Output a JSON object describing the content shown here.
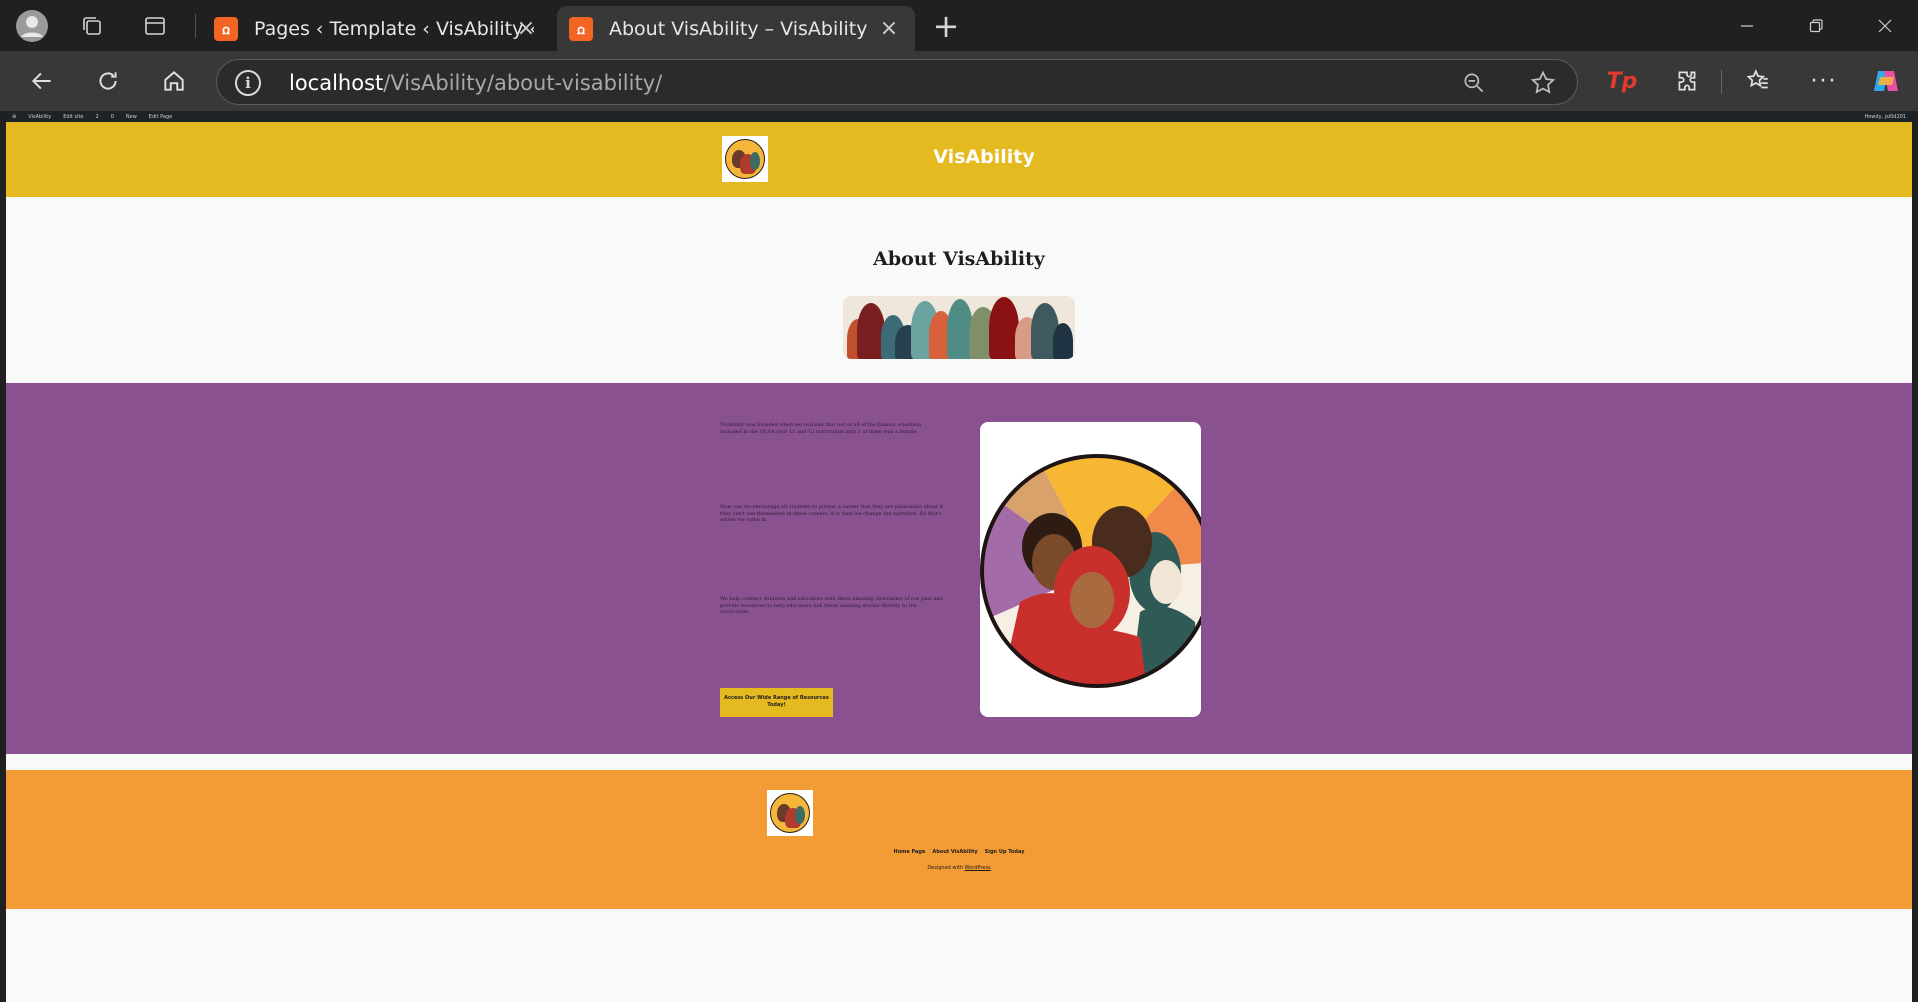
{
  "browser": {
    "tabs": [
      {
        "title": "Pages ‹ Template ‹ VisAbility ‹ Edit",
        "favicon": "xampp-icon",
        "active": false
      },
      {
        "title": "About VisAbility – VisAbility",
        "favicon": "xampp-icon",
        "active": true
      }
    ],
    "url_host": "localhost",
    "url_path": "/VisAbility/about-visability/",
    "toolbar_extension_label": "Tp"
  },
  "adminbar": {
    "items": [
      "VisAbility",
      "Edit site",
      "2",
      "0",
      "New",
      "Edit Page"
    ],
    "user": "Howdy, jsl0d201"
  },
  "site": {
    "title": "VisAbility",
    "colors": {
      "header": "#e5b920",
      "purple": "#8a5190",
      "footer": "#f39b35"
    }
  },
  "page": {
    "title": "About VisAbility",
    "paragraphs": [
      "VisAbility was founded when we realised that out of all of the famous scientists included in the QCAA year 11 and 12 curriculum only 1 of them was a female.",
      "How can we encourage all students to pursue a career that they are passionate about if they can't see themselves in these careers, it is time we change the narrative. So that's where we come in.",
      "We help connect students and educators with these amazing visionaries of our past and provide resources to help educators link these amazing stories directly to the curriculum."
    ],
    "cta_label": "Access Our Wide Range of Resources Today!"
  },
  "footer": {
    "nav": [
      "Home Page",
      "About VisAbility",
      "Sign Up Today"
    ],
    "credit_prefix": "Designed with",
    "credit_link": "WordPress"
  }
}
